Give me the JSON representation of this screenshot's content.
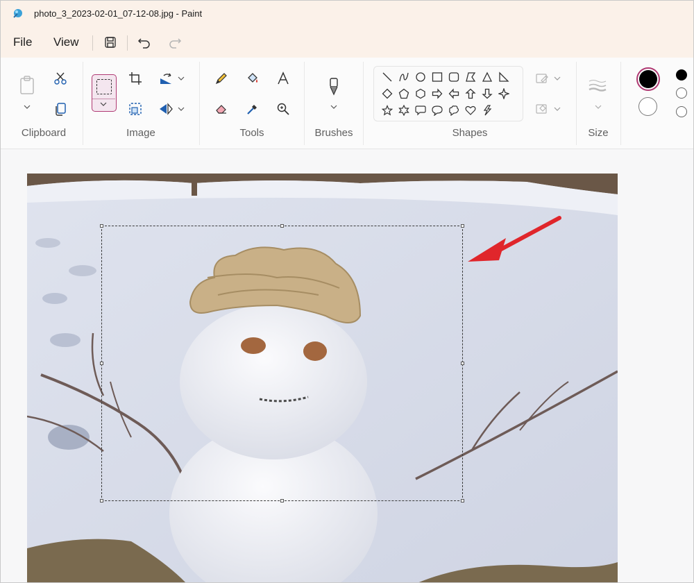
{
  "window": {
    "title": "photo_3_2023-02-01_07-12-08.jpg - Paint"
  },
  "menu": {
    "file": "File",
    "view": "View"
  },
  "ribbon": {
    "groups": {
      "clipboard": "Clipboard",
      "image": "Image",
      "tools": "Tools",
      "brushes": "Brushes",
      "shapes": "Shapes",
      "size": "Size"
    }
  },
  "colors": {
    "accent": "#b03a73",
    "color1": "#000000",
    "color2": "#ffffff",
    "annotation_arrow": "#e0262b"
  },
  "icons": {
    "app": "paint-icon",
    "save": "save-icon",
    "undo": "undo-icon",
    "redo": "redo-icon"
  }
}
